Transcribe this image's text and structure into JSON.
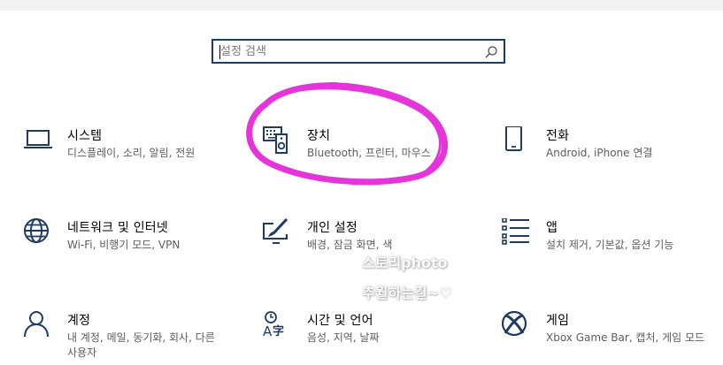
{
  "search": {
    "placeholder": "설정 검색",
    "value": ""
  },
  "tiles": [
    {
      "title": "시스템",
      "desc": "디스플레이, 소리, 알림, 전원",
      "icon": "laptop-icon"
    },
    {
      "title": "장치",
      "desc": "Bluetooth, 프린터, 마우스",
      "icon": "devices-icon"
    },
    {
      "title": "전화",
      "desc": "Android, iPhone 연결",
      "icon": "phone-icon"
    },
    {
      "title": "네트워크 및 인터넷",
      "desc": "Wi-Fi, 비행기 모드, VPN",
      "icon": "globe-icon"
    },
    {
      "title": "개인 설정",
      "desc": "배경, 잠금 화면, 색",
      "icon": "personalization-icon"
    },
    {
      "title": "앱",
      "desc": "설치 제거, 기본값, 옵션 기능",
      "icon": "apps-list-icon"
    },
    {
      "title": "계정",
      "desc": "내 계정, 메일, 동기화, 회사, 다른 사용자",
      "icon": "person-icon"
    },
    {
      "title": "시간 및 언어",
      "desc": "음성, 지역, 날짜",
      "icon": "time-language-icon"
    },
    {
      "title": "게임",
      "desc": "Xbox Game Bar, 캡처, 게임 모드",
      "icon": "xbox-icon"
    }
  ],
  "watermark": {
    "line1": "스토리photo",
    "line2": "추월하는길~♡"
  },
  "colors": {
    "icon": "#1f3b63",
    "annotation": "#e21fd6",
    "search_border": "#1f3b63"
  }
}
